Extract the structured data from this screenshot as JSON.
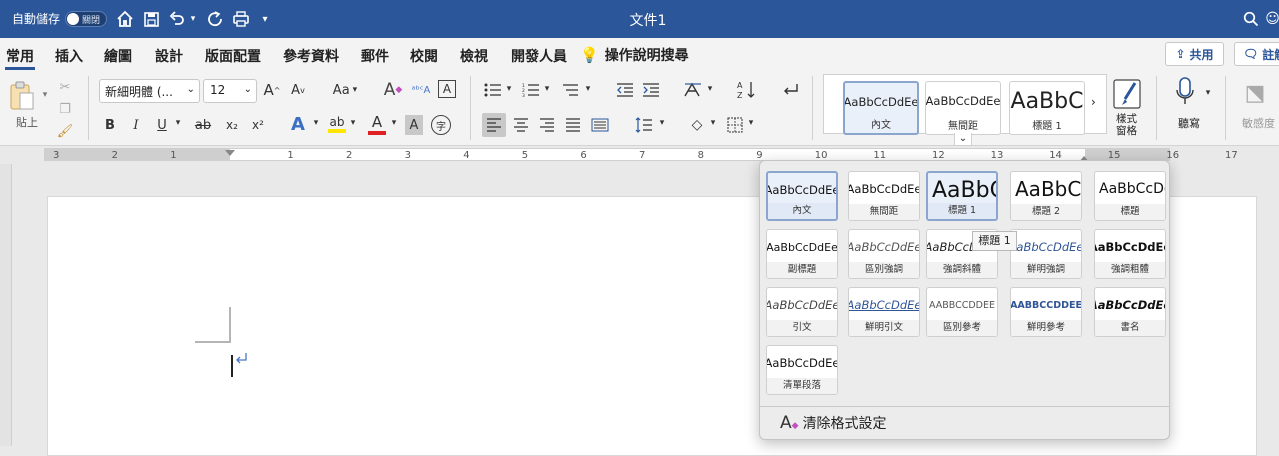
{
  "titlebar": {
    "autosave_label": "自動儲存",
    "autosave_state": "關閉",
    "doc_title": "文件1"
  },
  "tabs": [
    "常用",
    "插入",
    "繪圖",
    "設計",
    "版面配置",
    "參考資料",
    "郵件",
    "校閱",
    "檢視",
    "開發人員"
  ],
  "active_tab": "常用",
  "tell_me": "操作說明搜尋",
  "share_label": "共用",
  "comments_label": "註解",
  "clipboard": {
    "paste_label": "貼上"
  },
  "font": {
    "name": "新細明體 (...",
    "size": "12",
    "case_label": "Aa"
  },
  "format_buttons": {
    "bold": "B",
    "italic": "I",
    "underline": "U",
    "strike": "ab",
    "sub": "x₂",
    "sup": "x²",
    "effects": "A",
    "highlight": "ab",
    "font_color": "A",
    "shading": "A",
    "phonetic": "字"
  },
  "style_strip": [
    {
      "preview": "AaBbCcDdEe",
      "name": "內文"
    },
    {
      "preview": "AaBbCcDdEe",
      "name": "無間距"
    },
    {
      "preview": "AaBbC",
      "name": "標題 1"
    }
  ],
  "style_pane": {
    "label_line1": "樣式",
    "label_line2": "窗格"
  },
  "dictate_label": "聽寫",
  "sensitivity_label": "敏感度",
  "ruler_numbers": [
    "3",
    "2",
    "1",
    "",
    "1",
    "2",
    "3",
    "4",
    "5",
    "6",
    "7",
    "8",
    "9",
    "10",
    "11",
    "12",
    "13",
    "14",
    "15",
    "16",
    "17"
  ],
  "gallery": {
    "tooltip": "標題 1",
    "clear_formatting": "清除格式設定",
    "styles": [
      {
        "preview": "AaBbCcDdEe",
        "name": "內文",
        "selected": true
      },
      {
        "preview": "AaBbCcDdEe",
        "name": "無間距"
      },
      {
        "preview": "AaBbC",
        "name": "標題 1",
        "selected": true
      },
      {
        "preview": "AaBbC",
        "name": "標題 2"
      },
      {
        "preview": "AaBbCcDc",
        "name": "標題"
      },
      {
        "preview": "AaBbCcDdEe",
        "name": "副標題"
      },
      {
        "preview": "AaBbCcDdEe",
        "name": "區別強調"
      },
      {
        "preview": "AaBbCcDdEe",
        "name": "強調斜體"
      },
      {
        "preview": "AaBbCcDdEe",
        "name": "鮮明強調"
      },
      {
        "preview": "AaBbCcDdEe",
        "name": "強調粗體"
      },
      {
        "preview": "AaBbCcDdEe",
        "name": "引文"
      },
      {
        "preview": "AaBbCcDdEe",
        "name": "鮮明引文"
      },
      {
        "preview": "AABBCCDDEE",
        "name": "區別參考"
      },
      {
        "preview": "AABBCCDDEE",
        "name": "鮮明參考"
      },
      {
        "preview": "AaBbCcDdEe",
        "name": "書名"
      },
      {
        "preview": "AaBbCcDdEe",
        "name": "清單段落"
      }
    ]
  },
  "colors": {
    "titlebar": "#2b579a",
    "accent": "#2b579a",
    "font_color_bar": "#e02020",
    "highlight_bar": "#ffe600",
    "emphasis_blue": "#2f5597"
  }
}
